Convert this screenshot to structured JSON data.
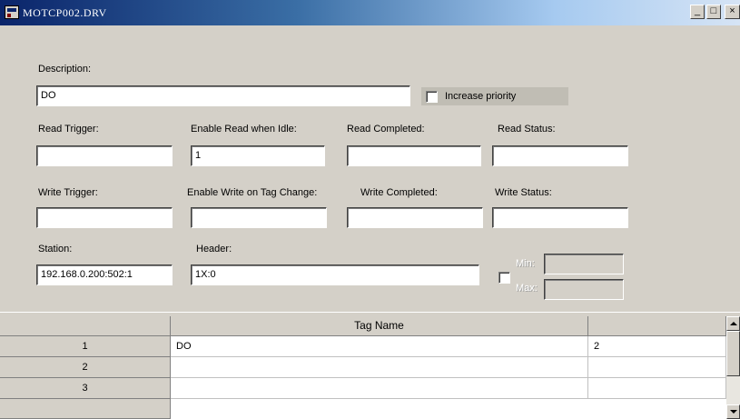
{
  "window": {
    "title": "MOTCP002.DRV",
    "controls": {
      "minimize": "_",
      "maximize": "□",
      "close": "×"
    }
  },
  "form": {
    "description": {
      "label": "Description:",
      "value": "DO"
    },
    "increase_priority": {
      "label": "Increase priority",
      "checked": false
    },
    "read_trigger": {
      "label": "Read Trigger:",
      "value": ""
    },
    "enable_read_idle": {
      "label": "Enable Read when Idle:",
      "value": "1"
    },
    "read_completed": {
      "label": "Read Completed:",
      "value": ""
    },
    "read_status": {
      "label": "Read Status:",
      "value": ""
    },
    "write_trigger": {
      "label": "Write Trigger:",
      "value": ""
    },
    "enable_write_change": {
      "label": "Enable Write on Tag Change:",
      "value": ""
    },
    "write_completed": {
      "label": "Write Completed:",
      "value": ""
    },
    "write_status": {
      "label": "Write Status:",
      "value": ""
    },
    "station": {
      "label": "Station:",
      "value": "192.168.0.200:502:1"
    },
    "header": {
      "label": "Header:",
      "value": "1X:0"
    },
    "scale": {
      "checked": false,
      "min_label": "Min:",
      "max_label": "Max:",
      "min_value": "",
      "max_value": ""
    }
  },
  "grid": {
    "columns": [
      "",
      "Tag Name",
      ""
    ],
    "rows": [
      {
        "index": "1",
        "tag_name": "DO",
        "address": "2"
      },
      {
        "index": "2",
        "tag_name": "",
        "address": ""
      },
      {
        "index": "3",
        "tag_name": "",
        "address": ""
      }
    ]
  }
}
